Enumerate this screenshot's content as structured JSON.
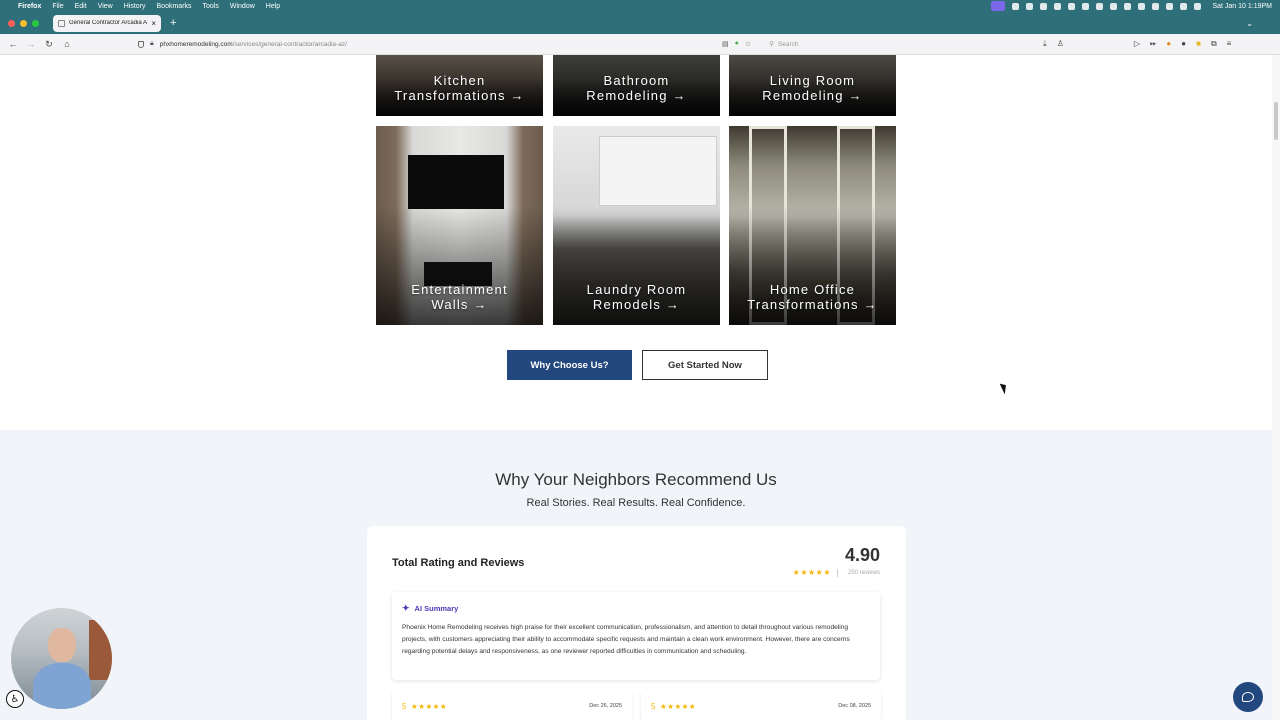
{
  "menubar": {
    "app": "Firefox",
    "items": [
      "File",
      "Edit",
      "View",
      "History",
      "Bookmarks",
      "Tools",
      "Window",
      "Help"
    ],
    "clock": "Sat Jan 10  1:19PM"
  },
  "browser": {
    "tab_title": "General Contractor Arcadia AZ |",
    "url_host": "phxhomeremodeling.com",
    "url_path": "/services/general-contractor/arcadia-az/",
    "search_placeholder": "Search"
  },
  "cards": [
    {
      "label": "Kitchen\nTransformations →"
    },
    {
      "label": "Bathroom\nRemodeling →"
    },
    {
      "label": "Living Room\nRemodeling →"
    },
    {
      "label": "Entertainment\nWalls →"
    },
    {
      "label": "Laundry Room\nRemodels →"
    },
    {
      "label": "Home Office\nTransformations →"
    }
  ],
  "buttons": {
    "why": "Why Choose Us?",
    "start": "Get Started Now"
  },
  "reviews": {
    "title": "Why Your Neighbors Recommend Us",
    "subtitle": "Real Stories. Real Results. Real Confidence.",
    "card_title": "Total Rating and Reviews",
    "score": "4.90",
    "stars": "★★★★★",
    "count": "250 reviews",
    "ai_label": "AI Summary",
    "ai_text": "Phoenix Home Remodeling receives high praise for their excellent communication, professionalism, and attention to detail throughout various remodeling projects, with customers appreciating their ability to accommodate specific requests and maintain a clean work environment. However, there are concerns regarding potential delays and responsiveness, as one reviewer reported difficulties in communication and scheduling.",
    "items": [
      {
        "score": "5",
        "stars": "★★★★★",
        "date": "Dec 26, 2025"
      },
      {
        "score": "5",
        "stars": "★★★★★",
        "date": "Dec 08, 2025"
      }
    ]
  },
  "colors": {
    "brand_blue": "#23477f",
    "star_gold": "#f2b705",
    "ai_purple": "#4a3bb5",
    "section_bg": "#f1f4f9"
  },
  "icons": [
    "apple-icon",
    "search-icon",
    "accessibility-icon",
    "chat-icon",
    "sparkle-icon",
    "lock-icon",
    "shield-icon"
  ]
}
